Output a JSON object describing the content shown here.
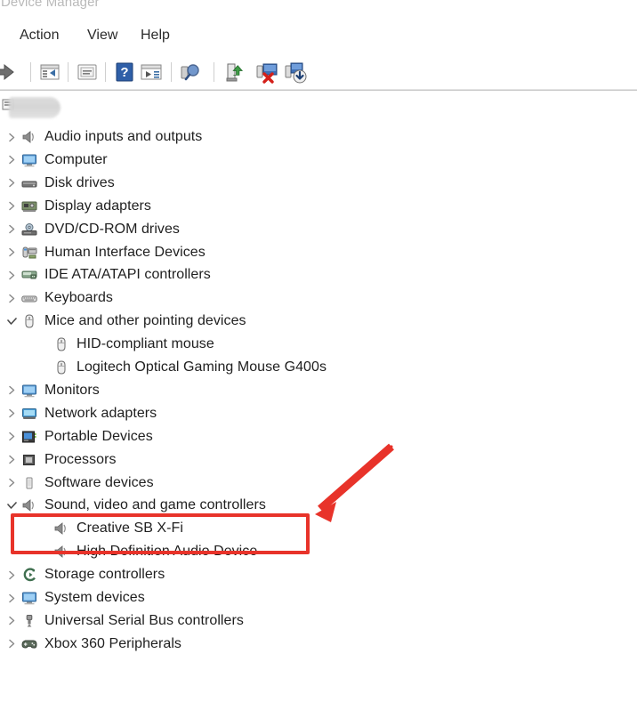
{
  "window": {
    "title": "Device Manager"
  },
  "menubar": {
    "items": [
      {
        "label": "Action",
        "name": "menu-action"
      },
      {
        "label": "View",
        "name": "menu-view"
      },
      {
        "label": "Help",
        "name": "menu-help"
      }
    ]
  },
  "toolbar": {
    "buttons": [
      {
        "icon": "back-arrow-icon",
        "tooltip": "Back"
      },
      {
        "icon": "properties-icon",
        "tooltip": "Properties"
      },
      {
        "icon": "show-hidden-devices-icon",
        "tooltip": "Show hidden devices"
      },
      {
        "icon": "help-icon",
        "tooltip": "Help"
      },
      {
        "icon": "device-details-icon",
        "tooltip": "Device details"
      },
      {
        "icon": "scan-for-hardware-changes-icon",
        "tooltip": "Scan for hardware changes"
      },
      {
        "icon": "update-driver-icon",
        "tooltip": "Update driver"
      },
      {
        "icon": "uninstall-device-icon",
        "tooltip": "Uninstall device"
      },
      {
        "icon": "disable-device-icon",
        "tooltip": "Disable device"
      }
    ]
  },
  "tree": {
    "root": {
      "label": "",
      "redacted": true,
      "icon": "computer-root-icon"
    },
    "nodes": [
      {
        "label": "Audio inputs and outputs",
        "icon": "speaker-icon",
        "level": 1,
        "state": "collapsed"
      },
      {
        "label": "Computer",
        "icon": "monitor-icon",
        "level": 1,
        "state": "collapsed"
      },
      {
        "label": "Disk drives",
        "icon": "disk-drive-icon",
        "level": 1,
        "state": "collapsed"
      },
      {
        "label": "Display adapters",
        "icon": "display-adapter-icon",
        "level": 1,
        "state": "collapsed"
      },
      {
        "label": "DVD/CD-ROM drives",
        "icon": "dvd-drive-icon",
        "level": 1,
        "state": "collapsed"
      },
      {
        "label": "Human Interface Devices",
        "icon": "hid-icon",
        "level": 1,
        "state": "collapsed"
      },
      {
        "label": "IDE ATA/ATAPI controllers",
        "icon": "ide-controller-icon",
        "level": 1,
        "state": "collapsed"
      },
      {
        "label": "Keyboards",
        "icon": "keyboard-icon",
        "level": 1,
        "state": "collapsed"
      },
      {
        "label": "Mice and other pointing devices",
        "icon": "mouse-icon",
        "level": 1,
        "state": "expanded"
      },
      {
        "label": "HID-compliant mouse",
        "icon": "mouse-icon",
        "level": 2,
        "state": "leaf"
      },
      {
        "label": "Logitech Optical Gaming Mouse G400s",
        "icon": "mouse-icon",
        "level": 2,
        "state": "leaf"
      },
      {
        "label": "Monitors",
        "icon": "monitor-icon",
        "level": 1,
        "state": "collapsed"
      },
      {
        "label": "Network adapters",
        "icon": "network-adapter-icon",
        "level": 1,
        "state": "collapsed"
      },
      {
        "label": "Portable Devices",
        "icon": "portable-device-icon",
        "level": 1,
        "state": "collapsed"
      },
      {
        "label": "Processors",
        "icon": "processor-icon",
        "level": 1,
        "state": "collapsed"
      },
      {
        "label": "Software devices",
        "icon": "software-device-icon",
        "level": 1,
        "state": "collapsed"
      },
      {
        "label": "Sound, video and game controllers",
        "icon": "speaker-icon",
        "level": 1,
        "state": "expanded",
        "highlighted": true
      },
      {
        "label": "Creative SB X-Fi",
        "icon": "speaker-icon",
        "level": 2,
        "state": "leaf",
        "highlighted": true
      },
      {
        "label": "High Definition Audio Device",
        "icon": "speaker-icon",
        "level": 2,
        "state": "leaf"
      },
      {
        "label": "Storage controllers",
        "icon": "storage-controller-icon",
        "level": 1,
        "state": "collapsed"
      },
      {
        "label": "System devices",
        "icon": "monitor-icon",
        "level": 1,
        "state": "collapsed"
      },
      {
        "label": "Universal Serial Bus controllers",
        "icon": "usb-icon",
        "level": 1,
        "state": "collapsed"
      },
      {
        "label": "Xbox 360 Peripherals",
        "icon": "gamepad-icon",
        "level": 1,
        "state": "collapsed"
      }
    ]
  },
  "annotations": {
    "highlight_box": {
      "name": "red-highlight-box",
      "color": "#e8332a",
      "targets": [
        "Sound, video and game controllers",
        "Creative SB X-Fi"
      ]
    },
    "arrow": {
      "name": "red-arrow-annotation",
      "color": "#e8332a",
      "direction": "down-left"
    }
  },
  "colors": {
    "annotation_red": "#e8332a",
    "text": "#1f1f1f",
    "title_text": "#b9b9b9",
    "background": "#ffffff"
  }
}
